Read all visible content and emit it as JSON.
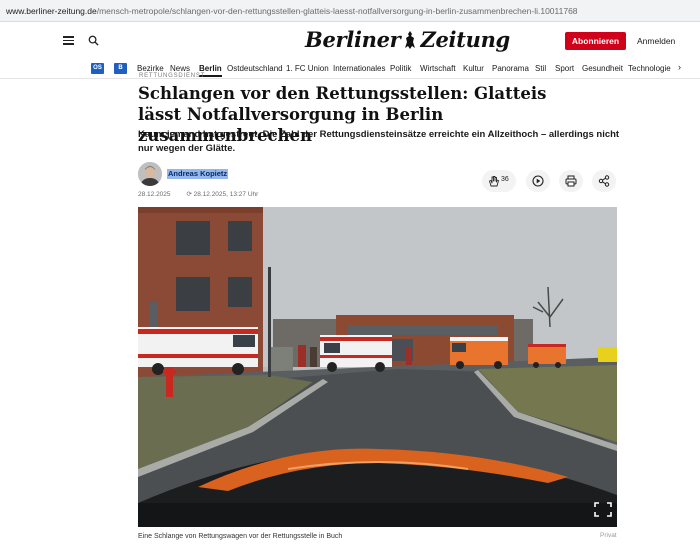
{
  "browser": {
    "url_host": "www.berliner-zeitung.de",
    "url_path": "/mensch-metropole/schlangen-vor-den-rettungsstellen-glatteis-laesst-notfallversorgung-in-berlin-zusammenbrechen-li.10011768"
  },
  "header": {
    "logo_part1": "Berliner",
    "logo_part2": "Zeitung",
    "subscribe_label": "Abonnieren",
    "login_label": "Anmelden"
  },
  "nav": {
    "badge_os": "OS",
    "badge_b": "B",
    "items": [
      "Bezirke",
      "News",
      "Berlin",
      "Ostdeutschland",
      "1. FC Union",
      "Internationales",
      "Politik",
      "Wirtschaft",
      "Kultur",
      "Panorama",
      "Stil",
      "Sport",
      "Gesundheit",
      "Technologie"
    ],
    "active": "Berlin"
  },
  "article": {
    "rubric": "Rettungsdienst",
    "headline": "Schlangen vor den Rettungsstellen: Glatteis lässt Notfallversorgung in Berlin zusammenbrechen",
    "teaser": "Kaum jemand hat gestreut. Die Zahl der Rettungsdiensteinsätze erreichte ein Allzeithoch – allerdings nicht nur wegen der Glätte.",
    "author": "Andreas Kopietz",
    "date": "28.12.2025",
    "updated": "28.12.2025, 13:27 Uhr",
    "clap_count": "36",
    "caption": "Eine Schlange von Rettungswagen vor der Rettungsstelle in Buch",
    "credit": "Privat"
  },
  "colors": {
    "accent_red": "#d0021b",
    "badge_blue": "#1e5fbf",
    "author_highlight": "#3c7ee0"
  }
}
